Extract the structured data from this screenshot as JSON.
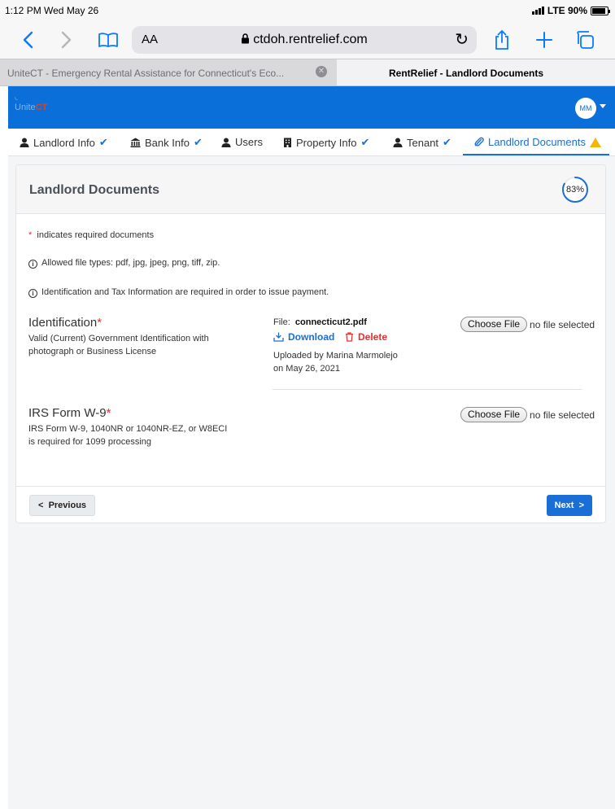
{
  "status_bar": {
    "time": "1:12 PM  Wed May 26",
    "network": "LTE 90%"
  },
  "browser": {
    "text_size_label": "AA",
    "url": "ctdoh.rentrelief.com",
    "tabs": [
      {
        "title": "UniteCT - Emergency Rental Assistance for Connecticut's Eco..."
      },
      {
        "title": "RentRelief - Landlord Documents"
      }
    ]
  },
  "app": {
    "logo_prefix": "Unite",
    "logo_suffix": "CT",
    "user_initials": "MM"
  },
  "steps": [
    {
      "label": "Landlord Info",
      "status": "complete"
    },
    {
      "label": "Bank Info",
      "status": "complete"
    },
    {
      "label": "Users",
      "status": "none"
    },
    {
      "label": "Property Info",
      "status": "complete"
    },
    {
      "label": "Tenant",
      "status": "complete"
    },
    {
      "label": "Landlord Documents",
      "status": "warning"
    }
  ],
  "card": {
    "title": "Landlord Documents",
    "progress_text": "83%",
    "progress_fraction": 0.83,
    "required_note": "indicates required documents",
    "file_types_note": "Allowed file types: pdf, jpg, jpeg, png, tiff, zip.",
    "payment_note": "Identification and Tax Information are required in order to issue payment."
  },
  "documents": {
    "identification": {
      "title": "Identification",
      "description_line1": "Valid (Current) Government Identification with",
      "description_line2": "photograph or Business License",
      "file_prefix": "File:",
      "file_name": "connecticut2.pdf",
      "download_label": "Download",
      "delete_label": "Delete",
      "uploaded_line1": "Uploaded by Marina Marmolejo",
      "uploaded_line2": "on May 26, 2021",
      "choose_label": "Choose File",
      "no_file_text": "no file selected"
    },
    "w9": {
      "title": "IRS Form W-9",
      "description_line1": "IRS Form W-9, 1040NR or 1040NR-EZ, or W8ECI",
      "description_line2": "is required for 1099 processing",
      "choose_label": "Choose File",
      "no_file_text": "no file selected"
    }
  },
  "footer": {
    "previous_label": "Previous",
    "next_label": "Next"
  },
  "colors": {
    "primary": "#1a6fd6",
    "header": "#0a6fd8",
    "danger": "#e03131",
    "warning": "#f2b705"
  }
}
